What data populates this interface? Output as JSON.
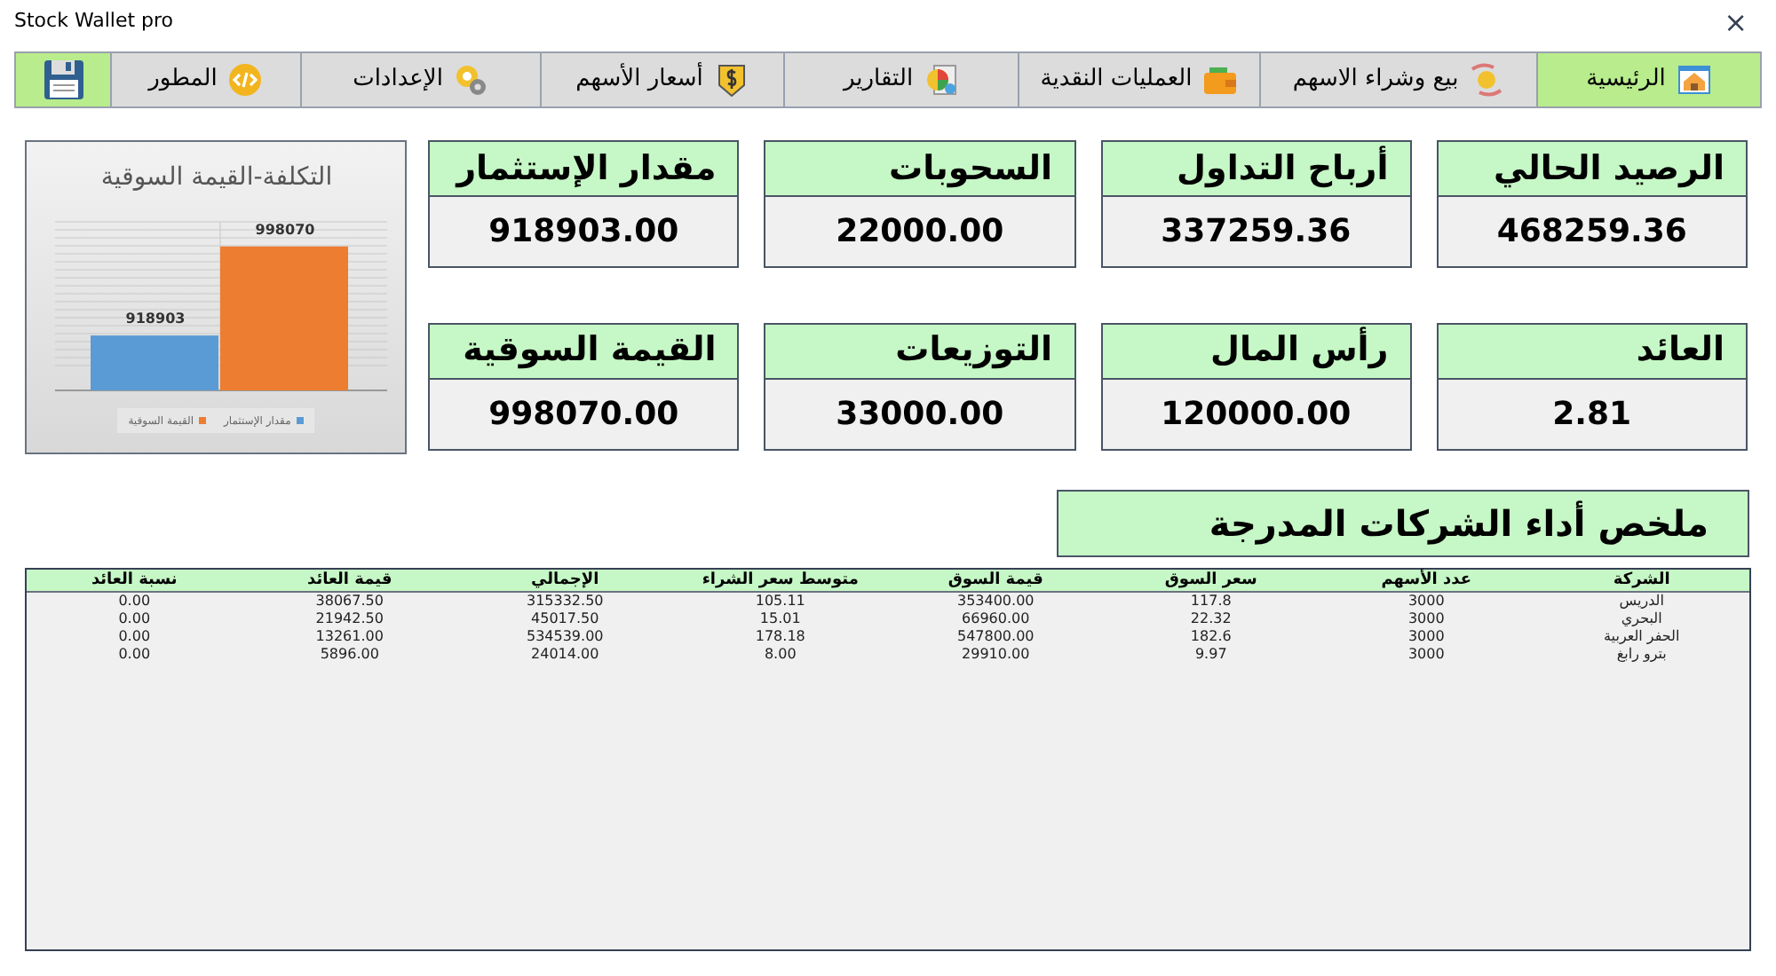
{
  "window": {
    "title": "Stock Wallet pro",
    "close": "×"
  },
  "tabs": [
    {
      "label": "الرئيسية",
      "selected": true
    },
    {
      "label": "بيع وشراء الاسهم",
      "selected": false
    },
    {
      "label": "العمليات النقدية",
      "selected": false
    },
    {
      "label": "التقارير",
      "selected": false
    },
    {
      "label": "أسعار الأسهم",
      "selected": false
    },
    {
      "label": "الإعدادات",
      "selected": false
    },
    {
      "label": "المطور",
      "selected": false
    }
  ],
  "cards": [
    {
      "label": "الرصيد الحالي",
      "value": "468259.36"
    },
    {
      "label": "أرباح التداول",
      "value": "337259.36"
    },
    {
      "label": "السحوبات",
      "value": "22000.00"
    },
    {
      "label": "مقدار الإستثمار",
      "value": "918903.00"
    },
    {
      "label": "العائد",
      "value": "2.81"
    },
    {
      "label": "رأس المال",
      "value": "120000.00"
    },
    {
      "label": "التوزيعات",
      "value": "33000.00"
    },
    {
      "label": "القيمة السوقية",
      "value": "998070.00"
    }
  ],
  "chart": {
    "chart_data": {
      "type": "bar",
      "title": "التكلفة-القيمة السوقية",
      "series": [
        {
          "name": "مقدار الإستثمار",
          "color": "#5b9bd5",
          "values": [
            918903
          ]
        },
        {
          "name": "القيمة السوقية",
          "color": "#ed7d31",
          "values": [
            998070
          ]
        }
      ],
      "ylim": [
        870000,
        1020000
      ],
      "data_labels": true
    }
  },
  "summary_title": "ملخص أداء الشركات المدرجة",
  "table": {
    "columns": [
      "الشركة",
      "عدد الأسهم",
      "سعر السوق",
      "قيمة السوق",
      "متوسط سعر الشراء",
      "الإجمالي",
      "قيمة العائد",
      "نسبة العائد"
    ],
    "rows": [
      [
        "الدريس",
        "3000",
        "117.8",
        "353400.00",
        "105.11",
        "315332.50",
        "38067.50",
        "0.00"
      ],
      [
        "البحري",
        "3000",
        "22.32",
        "66960.00",
        "15.01",
        "45017.50",
        "21942.50",
        "0.00"
      ],
      [
        "الحفر العربية",
        "3000",
        "182.6",
        "547800.00",
        "178.18",
        "534539.00",
        "13261.00",
        "0.00"
      ],
      [
        "بترو رابغ",
        "3000",
        "9.97",
        "29910.00",
        "8.00",
        "24014.00",
        "5896.00",
        "0.00"
      ]
    ]
  }
}
